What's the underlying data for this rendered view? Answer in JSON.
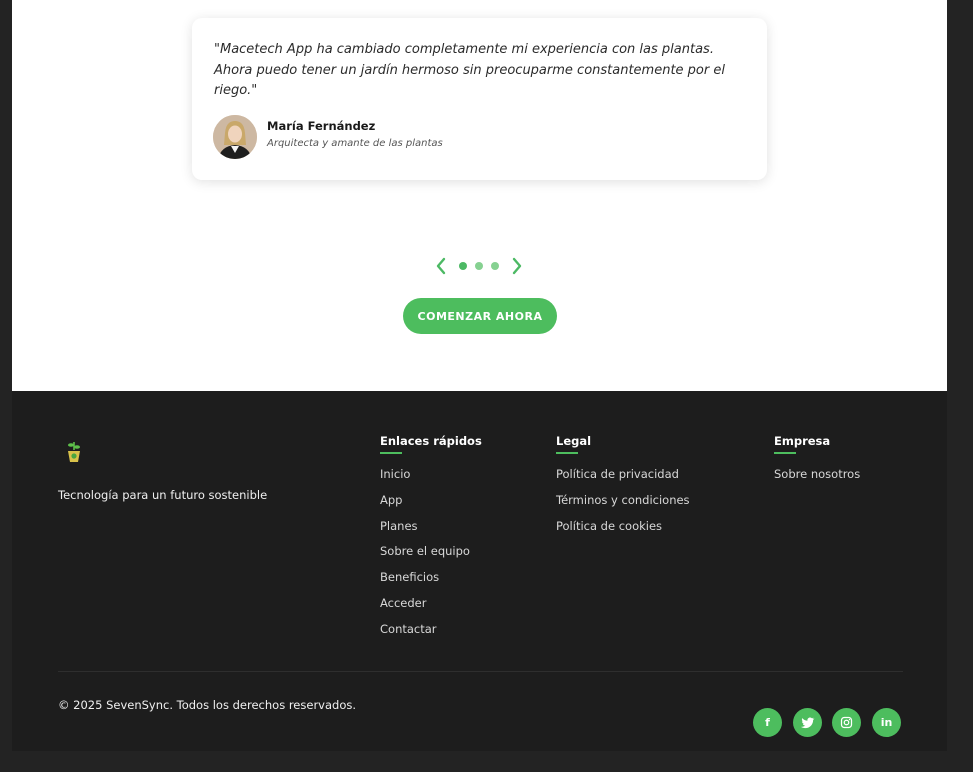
{
  "testimonial": {
    "quote": "\"Macetech App ha cambiado completamente mi experiencia con las plantas. Ahora puedo tener un jardín hermoso sin preocuparme constantemente por el riego.\"",
    "author_name": "María Fernández",
    "author_role": "Arquitecta y amante de las plantas"
  },
  "carousel": {
    "active_index": 1,
    "total": 3
  },
  "cta": {
    "label": "COMENZAR AHORA"
  },
  "footer": {
    "tagline": "Tecnología para un futuro sostenible",
    "columns": [
      {
        "title": "Enlaces rápidos",
        "links": [
          "Inicio",
          "App",
          "Planes",
          "Sobre el equipo",
          "Beneficios",
          "Acceder",
          "Contactar"
        ]
      },
      {
        "title": "Legal",
        "links": [
          "Política de privacidad",
          "Términos y condiciones",
          "Política de cookies"
        ]
      },
      {
        "title": "Empresa",
        "links": [
          "Sobre nosotros"
        ]
      }
    ],
    "copyright": "© 2025 SevenSync. Todos los derechos reservados.",
    "social": [
      {
        "name": "facebook-icon",
        "glyph": "f"
      },
      {
        "name": "twitter-icon",
        "glyph": ""
      },
      {
        "name": "instagram-icon",
        "glyph": ""
      },
      {
        "name": "linkedin-icon",
        "glyph": "in"
      }
    ]
  },
  "colors": {
    "accent": "#4dbd5e",
    "footer_bg": "#1d1d1d",
    "page_bg": "#ffffff"
  }
}
